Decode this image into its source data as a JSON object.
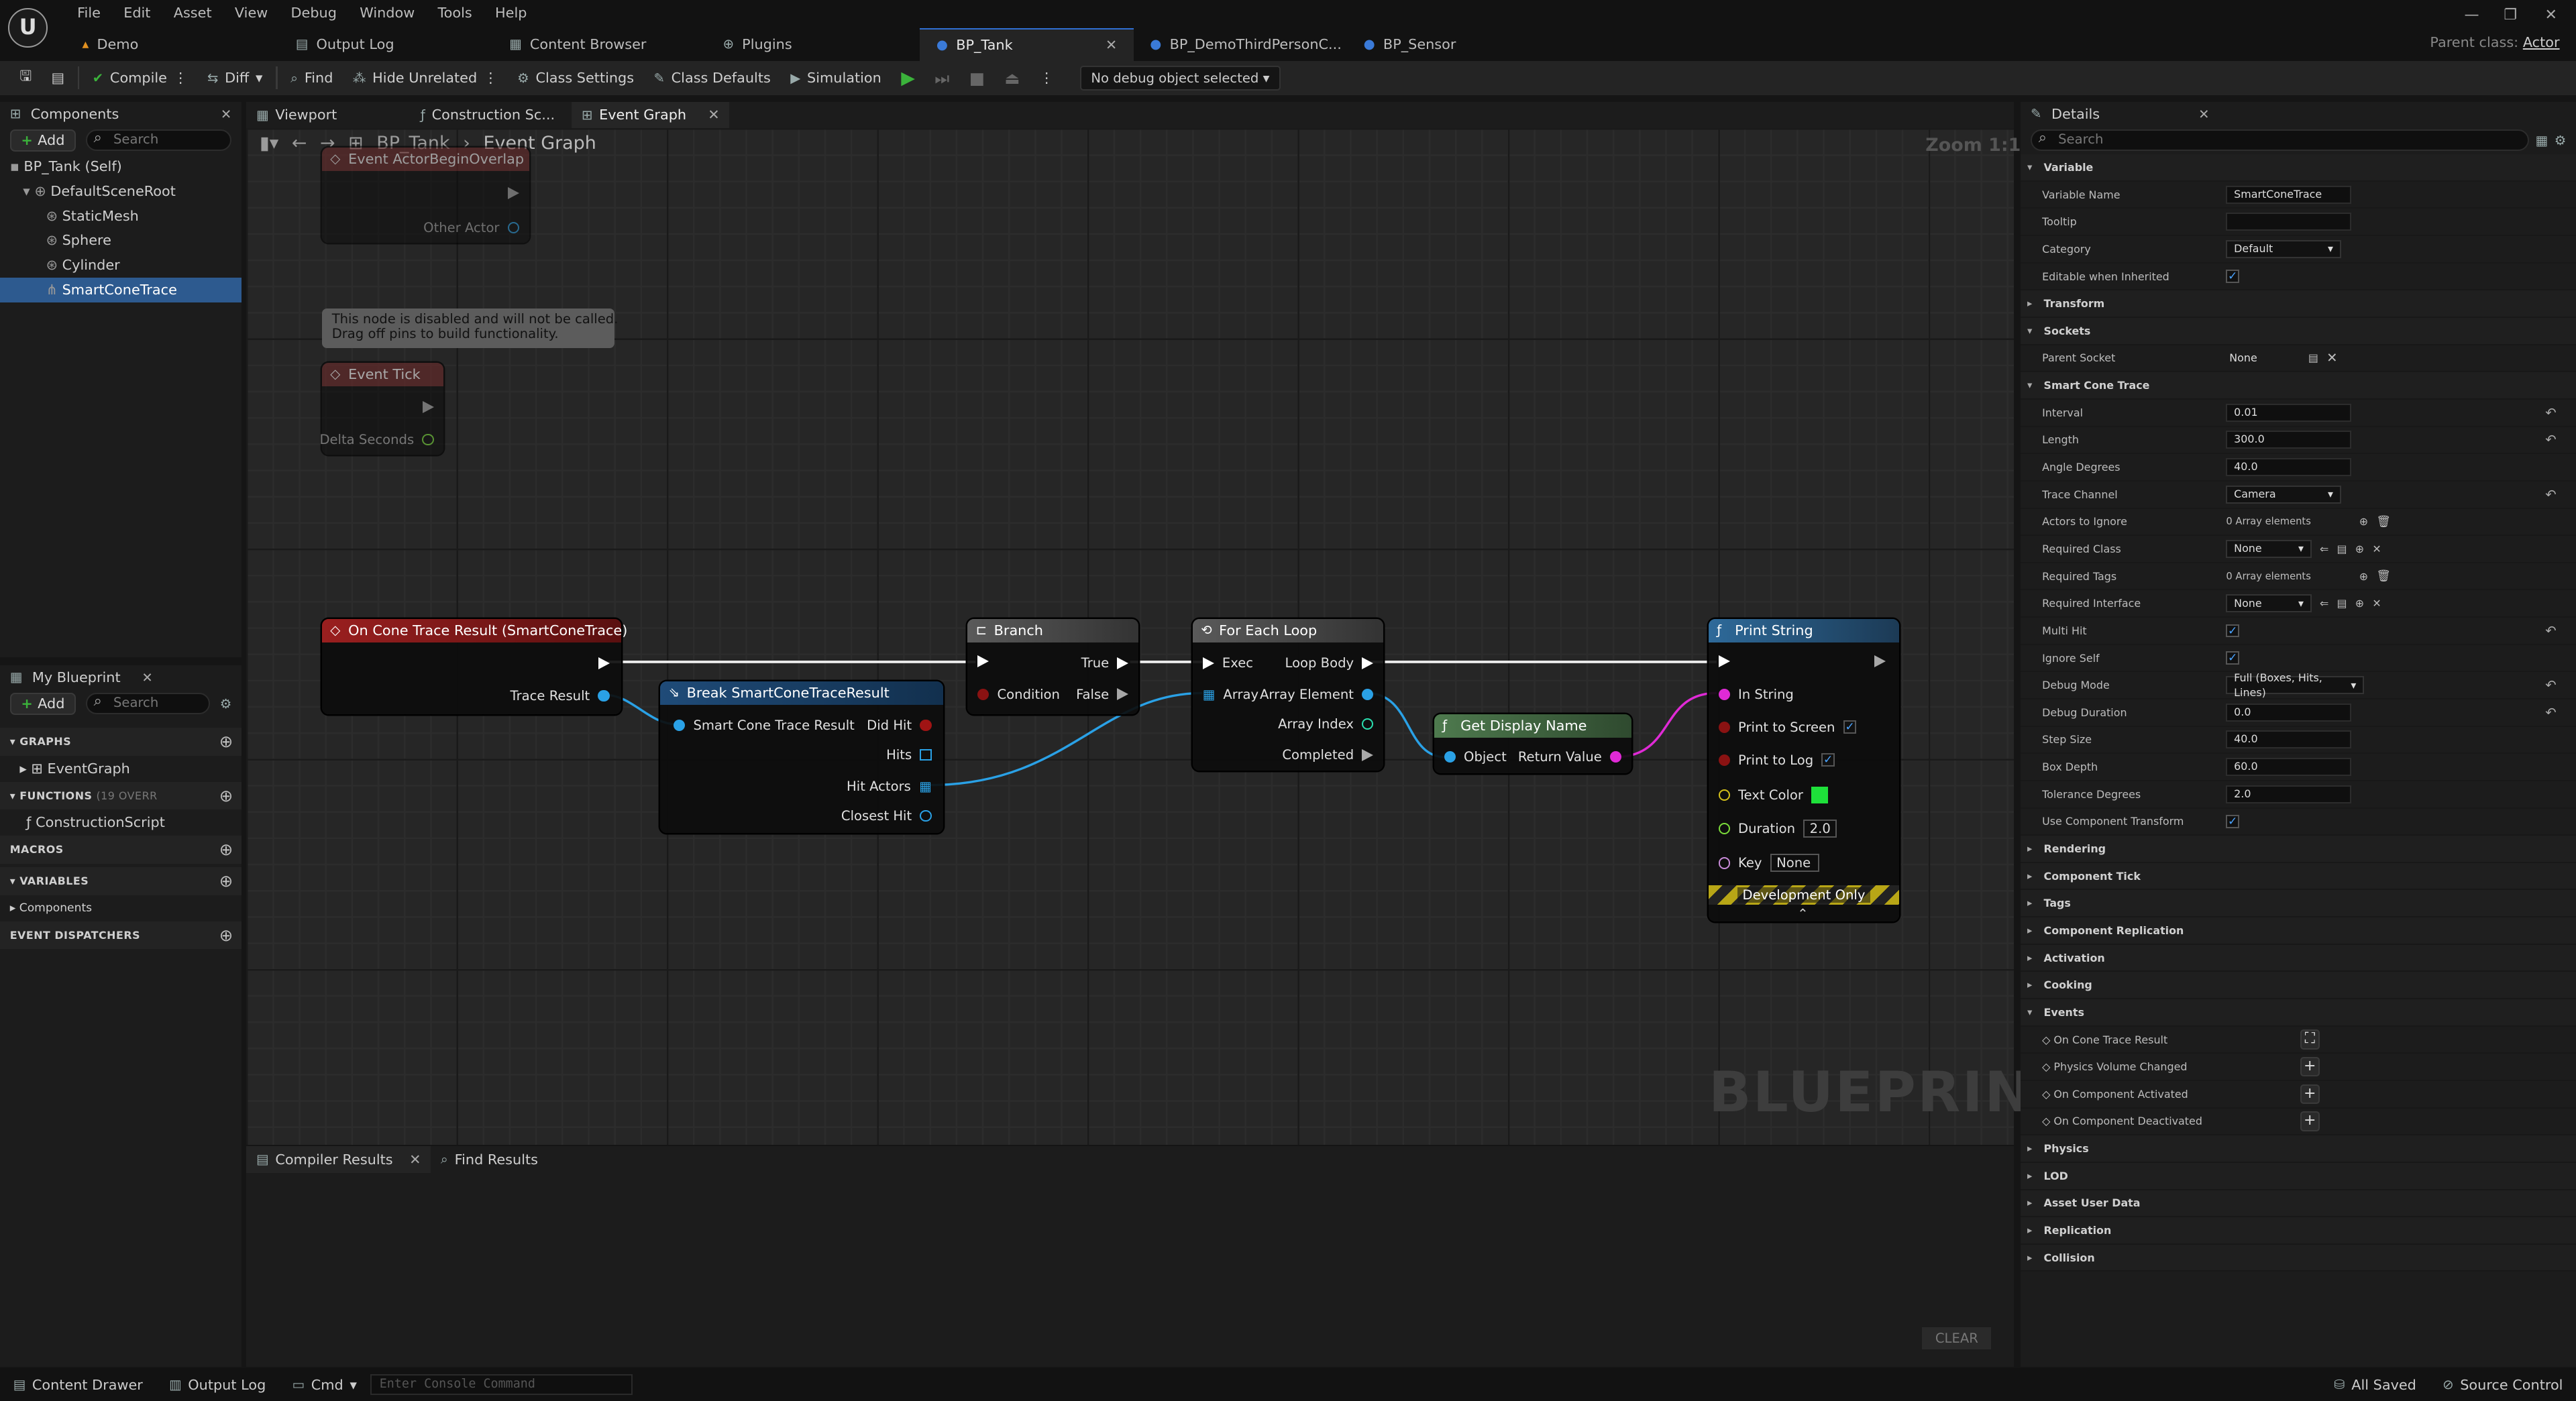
{
  "menu": [
    "File",
    "Edit",
    "Asset",
    "View",
    "Debug",
    "Window",
    "Tools",
    "Help"
  ],
  "tabs": [
    {
      "label": "Demo",
      "icon": "level-icon"
    },
    {
      "label": "Output Log",
      "icon": "log-icon"
    },
    {
      "label": "Content Browser",
      "icon": "folder-icon"
    },
    {
      "label": "Plugins",
      "icon": "plugin-icon"
    },
    {
      "label": "BP_Tank",
      "icon": "blueprint-icon"
    },
    {
      "label": "BP_DemoThirdPersonC...",
      "icon": "blueprint-icon"
    },
    {
      "label": "BP_Sensor",
      "icon": "blueprint-icon"
    }
  ],
  "parent_class_label": "Parent class:",
  "parent_class_value": "Actor",
  "toolbar": {
    "compile": "Compile",
    "diff": "Diff",
    "find": "Find",
    "hide_unrelated": "Hide Unrelated",
    "class_settings": "Class Settings",
    "class_defaults": "Class Defaults",
    "simulation": "Simulation",
    "debug_object": "No debug object selected"
  },
  "components": {
    "title": "Components",
    "add": "Add",
    "search_placeholder": "Search",
    "items": [
      "BP_Tank (Self)",
      "DefaultSceneRoot",
      "StaticMesh",
      "Sphere",
      "Cylinder",
      "SmartConeTrace"
    ]
  },
  "editor_tabs": [
    "Viewport",
    "Construction Sc...",
    "Event Graph"
  ],
  "breadcrumb": {
    "root": "BP_Tank",
    "current": "Event Graph"
  },
  "zoom": "Zoom 1:1",
  "watermark": "BLUEPRINT",
  "my_blueprint": {
    "title": "My Blueprint",
    "add": "Add",
    "search_placeholder": "Search",
    "graphs": "GRAPHS",
    "event_graph": "EventGraph",
    "functions": "FUNCTIONS",
    "functions_count": "(19 OVERR",
    "construction": "ConstructionScript",
    "macros": "MACROS",
    "variables": "VARIABLES",
    "components": "Components",
    "dispatchers": "EVENT DISPATCHERS"
  },
  "nodes": {
    "overlap": {
      "title": "Event ActorBeginOverlap",
      "pin": "Other Actor"
    },
    "disabled_note": "This node is disabled and will not be called.\nDrag off pins to build functionality.",
    "tick": {
      "title": "Event Tick",
      "pin": "Delta Seconds"
    },
    "cone": {
      "title": "On Cone Trace Result (SmartConeTrace)",
      "pin": "Trace Result"
    },
    "breakr": {
      "title": "Break SmartConeTraceResult",
      "in": "Smart Cone Trace Result",
      "did_hit": "Did Hit",
      "hits": "Hits",
      "hit_actors": "Hit Actors",
      "closest": "Closest Hit"
    },
    "branch": {
      "title": "Branch",
      "cond": "Condition",
      "t": "True",
      "f": "False"
    },
    "loop": {
      "title": "For Each Loop",
      "exec": "Exec",
      "array": "Array",
      "body": "Loop Body",
      "elem": "Array Element",
      "idx": "Array Index",
      "done": "Completed"
    },
    "getname": {
      "title": "Get Display Name",
      "obj": "Object",
      "ret": "Return Value"
    },
    "print": {
      "title": "Print String",
      "instr": "In String",
      "screen": "Print to Screen",
      "log": "Print to Log",
      "color": "Text Color",
      "duration": "Duration",
      "duration_val": "2.0",
      "key": "Key",
      "key_val": "None",
      "dev": "Development Only"
    }
  },
  "bottom_tabs": [
    "Compiler Results",
    "Find Results"
  ],
  "clear": "CLEAR",
  "details": {
    "title": "Details",
    "search_placeholder": "Search",
    "variable": "Variable",
    "var_name": "Variable Name",
    "var_name_val": "SmartConeTrace",
    "tooltip": "Tooltip",
    "category": "Category",
    "category_val": "Default",
    "editable": "Editable when Inherited",
    "transform": "Transform",
    "sockets": "Sockets",
    "parent_socket": "Parent Socket",
    "parent_socket_val": "None",
    "sct": "Smart Cone Trace",
    "props": [
      {
        "label": "Interval",
        "value": "0.01",
        "kind": "field",
        "reset": true
      },
      {
        "label": "Length",
        "value": "300.0",
        "kind": "field",
        "reset": true
      },
      {
        "label": "Angle Degrees",
        "value": "40.0",
        "kind": "field",
        "reset": false
      },
      {
        "label": "Trace Channel",
        "value": "Camera",
        "kind": "combo",
        "reset": true
      },
      {
        "label": "Actors to Ignore",
        "value": "0 Array elements",
        "kind": "array",
        "reset": false
      },
      {
        "label": "Required Class",
        "value": "None",
        "kind": "class",
        "reset": false
      },
      {
        "label": "Required Tags",
        "value": "0 Array elements",
        "kind": "array",
        "reset": false
      },
      {
        "label": "Required Interface",
        "value": "None",
        "kind": "class",
        "reset": false
      },
      {
        "label": "Multi Hit",
        "value": "",
        "kind": "check",
        "reset": true
      },
      {
        "label": "Ignore Self",
        "value": "",
        "kind": "check",
        "reset": false
      },
      {
        "label": "Debug Mode",
        "value": "Full (Boxes, Hits, Lines)",
        "kind": "combo",
        "reset": true
      },
      {
        "label": "Debug Duration",
        "value": "0.0",
        "kind": "field",
        "reset": true
      },
      {
        "label": "Step Size",
        "value": "40.0",
        "kind": "field",
        "reset": false
      },
      {
        "label": "Box Depth",
        "value": "60.0",
        "kind": "field",
        "reset": false
      },
      {
        "label": "Tolerance Degrees",
        "value": "2.0",
        "kind": "field",
        "reset": false
      },
      {
        "label": "Use Component Transform",
        "value": "",
        "kind": "check",
        "reset": false
      }
    ],
    "cats_mid": [
      "Rendering",
      "Component Tick",
      "Tags",
      "Component Replication",
      "Activation",
      "Cooking"
    ],
    "events": "Events",
    "event_items": [
      "On Cone Trace Result",
      "Physics Volume Changed",
      "On Component Activated",
      "On Component Deactivated"
    ],
    "cats_end": [
      "Physics",
      "LOD",
      "Asset User Data",
      "Replication",
      "Collision"
    ]
  },
  "status": {
    "drawer": "Content Drawer",
    "log": "Output Log",
    "cmd": "Cmd",
    "console_placeholder": "Enter Console Command",
    "saved": "All Saved",
    "source": "Source Control"
  }
}
